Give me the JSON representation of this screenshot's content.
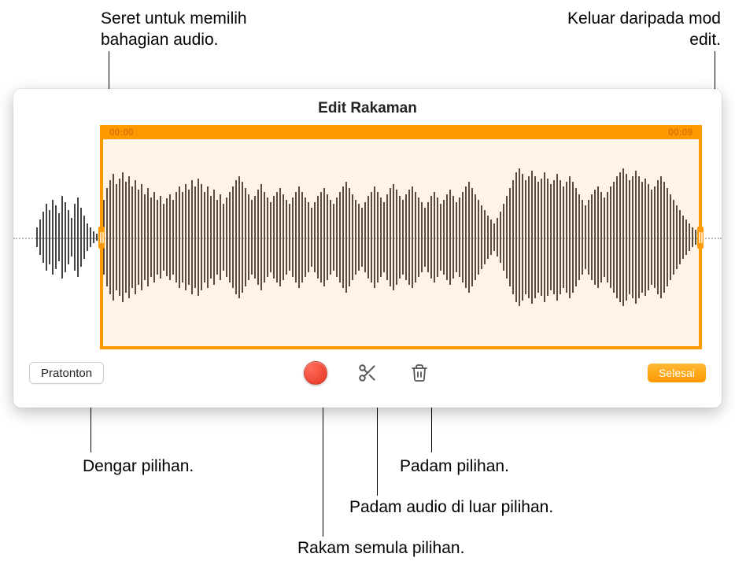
{
  "callouts": {
    "top_left": "Seret untuk memilih bahagian audio.",
    "top_right": "Keluar daripada mod edit.",
    "preview": "Dengar pilihan.",
    "delete": "Padam pilihan.",
    "trim": "Padam audio di luar pilihan.",
    "record": "Rakam semula pilihan."
  },
  "editor": {
    "title": "Edit Rakaman",
    "time_start": "00:00",
    "time_end": "00:09"
  },
  "toolbar": {
    "preview_label": "Pratonton",
    "done_label": "Selesai"
  },
  "icons": {
    "record": "record-icon",
    "trim": "scissors-icon",
    "delete": "trash-icon"
  },
  "colors": {
    "accent": "#ff9900",
    "record": "#e8341f"
  }
}
